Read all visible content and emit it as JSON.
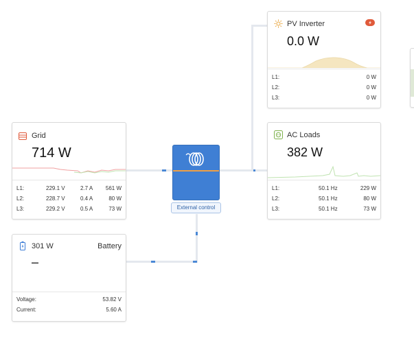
{
  "grid": {
    "title": "Grid",
    "power": "714 W",
    "rows": [
      {
        "label": "L1:",
        "voltage": "229.1 V",
        "current": "2.7 A",
        "power": "561 W"
      },
      {
        "label": "L2:",
        "voltage": "228.7 V",
        "current": "0.4 A",
        "power": "80 W"
      },
      {
        "label": "L3:",
        "voltage": "229.2 V",
        "current": "0.5 A",
        "power": "73 W"
      }
    ]
  },
  "pv_inverter": {
    "title": "PV Inverter",
    "power": "0.0 W",
    "rows": [
      {
        "label": "L1:",
        "value": "0 W"
      },
      {
        "label": "L2:",
        "value": "0 W"
      },
      {
        "label": "L3:",
        "value": "0 W"
      }
    ]
  },
  "ac_loads": {
    "title": "AC Loads",
    "power": "382 W",
    "rows": [
      {
        "label": "L1:",
        "frequency": "50.1 Hz",
        "power": "229 W"
      },
      {
        "label": "L2:",
        "frequency": "50.1 Hz",
        "power": "80 W"
      },
      {
        "label": "L3:",
        "frequency": "50.1 Hz",
        "power": "73 W"
      }
    ]
  },
  "battery": {
    "title": "Battery",
    "power": "301 W",
    "state": "–",
    "rows": [
      {
        "label": "Voltage:",
        "value": "53.82 V"
      },
      {
        "label": "Current:",
        "value": "5.60 A"
      }
    ]
  },
  "inverter": {
    "control_label": "External control"
  },
  "colors": {
    "grid_icon": "#e05a3a",
    "pv_icon": "#e8a33a",
    "ac_icon": "#7fb24e",
    "battery_icon": "#3a7bd5",
    "inverter_blue": "#3f7fd4",
    "connector_marker": "#4a88d5",
    "sparkline_green": "#bfe3b0",
    "sparkline_red": "#f0a0a0",
    "pv_area": "#f5e6c0"
  },
  "icons": {
    "grid": "grid-icon",
    "pv": "sun-icon",
    "ac": "socket-icon",
    "battery": "battery-icon",
    "pv_badge": "alert-badge-icon",
    "inverter": "victron-logo-icon"
  }
}
